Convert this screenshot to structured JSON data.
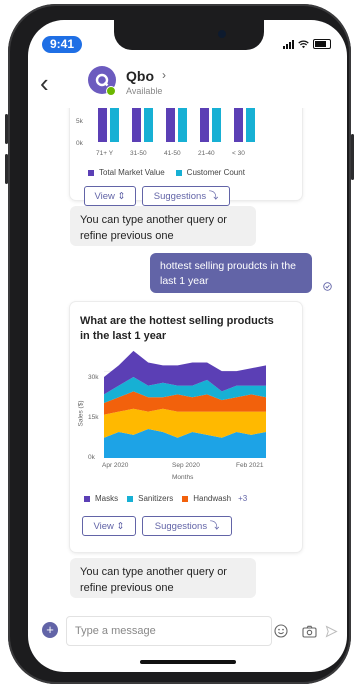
{
  "status": {
    "time": "9:41"
  },
  "header": {
    "bot_name": "Qbo",
    "bot_status": "Available"
  },
  "top_card": {
    "y_ticks": [
      "5k",
      "0k"
    ],
    "categories": [
      "71+ Y",
      "31-50",
      "41-50",
      "21-40",
      "< 30"
    ],
    "legend": [
      {
        "label": "Total Market Value",
        "color": "#5b3fb5"
      },
      {
        "label": "Customer Count",
        "color": "#17b0d4"
      }
    ],
    "view_label": "View",
    "suggestions_label": "Suggestions"
  },
  "messages": {
    "bot_1": "You can type another query or refine previous one",
    "user_1": "hottest selling proudcts in the last 1 year",
    "bot_2": "You can type another query or refine previous one"
  },
  "chart_card": {
    "title": "What are the hottest selling products in the last 1 year",
    "view_label": "View",
    "suggestions_label": "Suggestions",
    "legend_more": "+3"
  },
  "chart_data": {
    "type": "area",
    "stacked": true,
    "xlabel": "Months",
    "ylabel": "Sales ($)",
    "y_ticks": [
      "30k",
      "15k",
      "0k"
    ],
    "x_ticks": [
      "Apr 2020",
      "Sep 2020",
      "Feb 2021"
    ],
    "ylim": [
      0,
      38000
    ],
    "x": [
      0,
      1,
      2,
      3,
      4,
      5,
      6,
      7,
      8,
      9,
      10,
      11
    ],
    "series": [
      {
        "name": "",
        "color": "#1da3e6",
        "values": [
          7000,
          9000,
          8000,
          10000,
          9000,
          7000,
          9000,
          8000,
          7000,
          9000,
          8000,
          9000
        ]
      },
      {
        "name": "",
        "color": "#ffb900",
        "values": [
          8000,
          7000,
          9000,
          6000,
          8000,
          9000,
          7000,
          8000,
          9000,
          7000,
          8000,
          7000
        ]
      },
      {
        "name": "Handwash",
        "color": "#f2610c",
        "values": [
          4000,
          5000,
          6000,
          5000,
          4000,
          6000,
          5000,
          6000,
          4000,
          5000,
          6000,
          5000
        ]
      },
      {
        "name": "Sanitizers",
        "color": "#17b0d4",
        "values": [
          3000,
          4000,
          5000,
          4000,
          5000,
          3000,
          4000,
          5000,
          3000,
          4000,
          3000,
          4000
        ]
      },
      {
        "name": "Masks",
        "color": "#5b3fb5",
        "values": [
          6000,
          7000,
          9000,
          8000,
          6000,
          7000,
          8000,
          6000,
          7000,
          5000,
          6000,
          7000
        ]
      }
    ],
    "legend": [
      {
        "label": "Masks",
        "color": "#5b3fb5"
      },
      {
        "label": "Sanitizers",
        "color": "#17b0d4"
      },
      {
        "label": "Handwash",
        "color": "#f2610c"
      }
    ]
  },
  "compose": {
    "placeholder": "Type a message"
  }
}
